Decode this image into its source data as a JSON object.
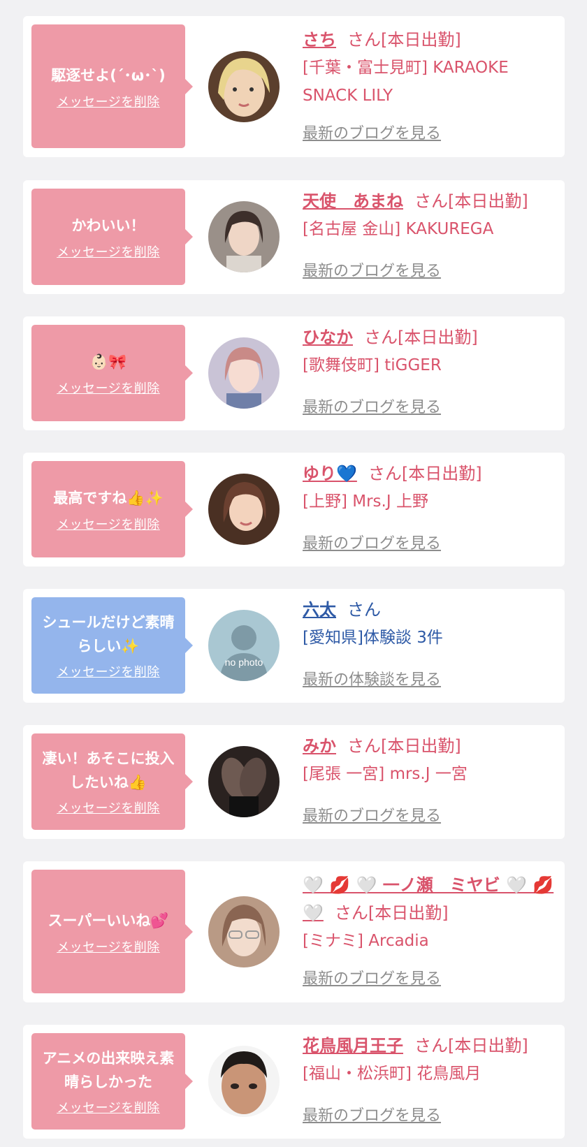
{
  "delete_label": "メッセージを削除",
  "san": "さん",
  "cards": [
    {
      "message": "駆逐せよ(´･ω･`)",
      "name": "さち",
      "status": "さん[本日出勤]",
      "shop": "[千葉・富士見町] KARAOKE SNACK LILY",
      "link": "最新のブログを見る"
    },
    {
      "message": "かわいい！",
      "name": "天使　あまね",
      "status": "さん[本日出勤]",
      "shop": "[名古屋 金山] KAKUREGA",
      "link": "最新のブログを見る"
    },
    {
      "message": "👶🏻🎀",
      "name": "ひなか",
      "status": "さん[本日出勤]",
      "shop": "[歌舞伎町] tiGGER",
      "link": "最新のブログを見る"
    },
    {
      "message": "最高ですね👍✨",
      "name": "ゆり💙",
      "status": "さん[本日出勤]",
      "shop": "[上野] Mrs.J 上野",
      "link": "最新のブログを見る"
    },
    {
      "message": "シュールだけど素晴らしい✨",
      "name": "六太",
      "status": "さん",
      "shop": "[愛知県]体験談 3件",
      "link": "最新の体験談を見る",
      "avatar_text": "no photo"
    },
    {
      "message": "凄い！あそこに投入したいね👍",
      "name": "みか",
      "status": "さん[本日出勤]",
      "shop": "[尾張 一宮] mrs.J 一宮",
      "link": "最新のブログを見る"
    },
    {
      "message": "スーパーいいね💕",
      "name": "🤍 💋 🤍 一ノ瀬　ミヤビ 🤍 💋 🤍",
      "status": "さん[本日出勤]",
      "shop": "[ミナミ] Arcadia",
      "link": "最新のブログを見る"
    },
    {
      "message": "アニメの出来映え素晴らしかった",
      "name": "花鳥風月王子",
      "status": "さん[本日出勤]",
      "shop": "[福山・松浜町] 花鳥風月",
      "link": "最新のブログを見る"
    }
  ],
  "colors": {
    "pink_accent": "#d9536b",
    "bubble_pink": "#ee9aa7",
    "bubble_blue": "#94b5ec",
    "link_gray": "#8d8d8d",
    "user_blue": "#2e5aa6"
  },
  "avatar_icons": [
    "avatar-blonde",
    "avatar-dark-hair",
    "avatar-pink-hair",
    "avatar-brown-hair",
    "avatar-no-photo",
    "avatar-legs",
    "avatar-glasses",
    "avatar-man"
  ]
}
